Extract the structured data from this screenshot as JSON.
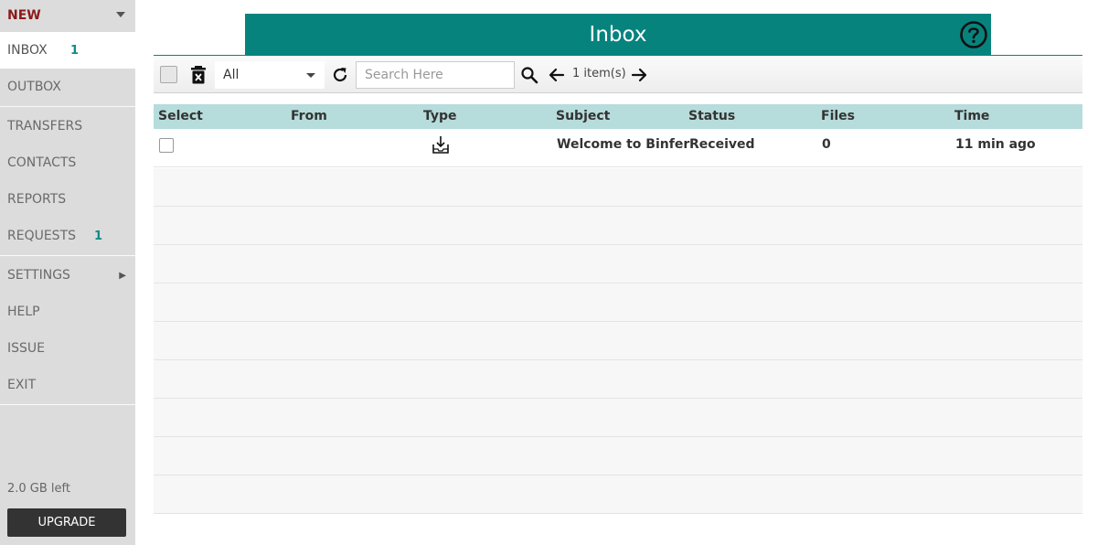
{
  "sidebar": {
    "new_label": "NEW",
    "items": [
      {
        "label": "INBOX",
        "count": "1"
      },
      {
        "label": "OUTBOX"
      },
      {
        "label": "TRANSFERS"
      },
      {
        "label": "CONTACTS"
      },
      {
        "label": "REPORTS"
      },
      {
        "label": "REQUESTS",
        "count": "1"
      },
      {
        "label": "SETTINGS"
      },
      {
        "label": "HELP"
      },
      {
        "label": "ISSUE"
      },
      {
        "label": "EXIT"
      }
    ],
    "storage": "2.0 GB left",
    "upgrade_label": "UPGRADE"
  },
  "header": {
    "title": "Inbox",
    "accent_color": "#07837e"
  },
  "toolbar": {
    "filter_value": "All",
    "search_placeholder": "Search Here",
    "item_count": "1 item(s)"
  },
  "table": {
    "columns": [
      "Select",
      "From",
      "Type",
      "Subject",
      "Status",
      "Files",
      "Time"
    ],
    "rows": [
      {
        "from": "",
        "type_icon": "download-tray-icon",
        "subject": "Welcome to Binfer",
        "status": "Received",
        "files": "0",
        "time": "11 min ago"
      }
    ],
    "header_color": "#b6dcdb"
  }
}
